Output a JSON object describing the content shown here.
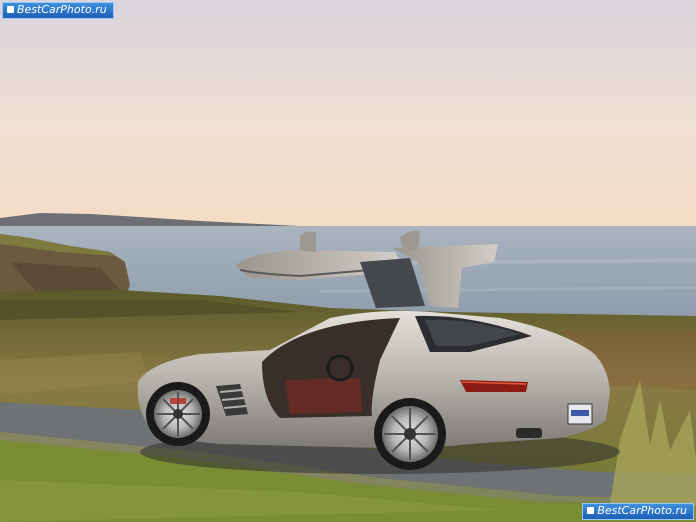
{
  "watermark": {
    "top_text": "BestCarPhoto.ru",
    "bottom_text": "BestCarPhoto.ru"
  },
  "scene": {
    "sky_top_color": "#ddd6dc",
    "sky_horizon_color": "#f3dcc4",
    "sea_color": "#9aa7b4",
    "grass_color": "#7a7a3a",
    "road_color": "#6f7274",
    "car_body_color": "#b9b4ad"
  }
}
